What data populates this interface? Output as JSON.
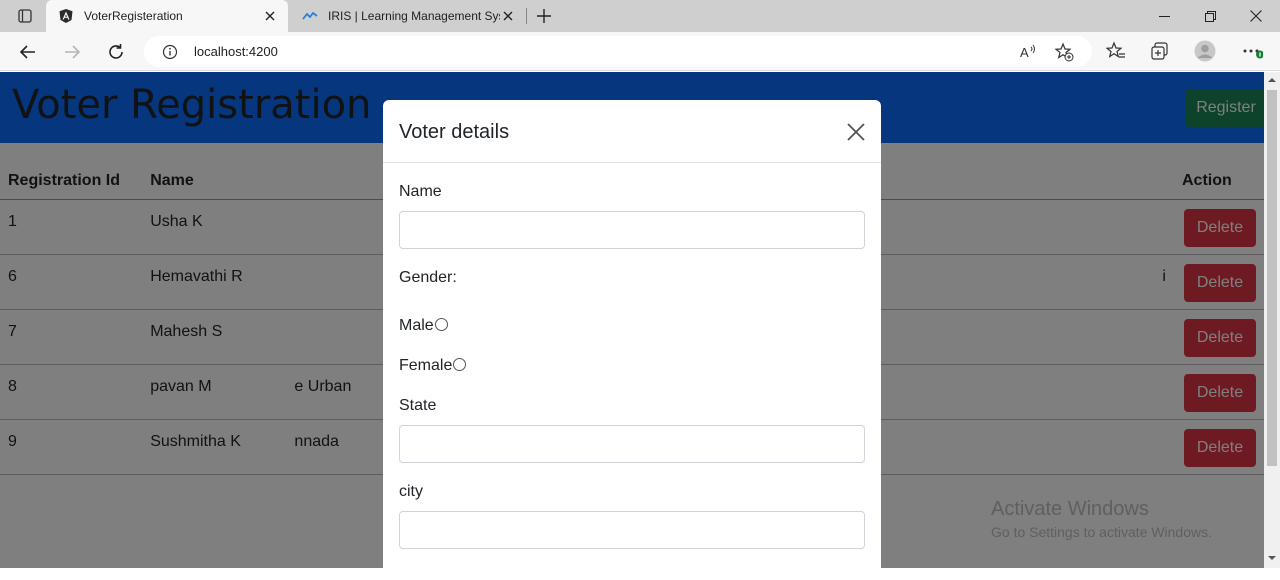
{
  "browser": {
    "tabs": [
      {
        "label": "VoterRegisteration",
        "icon": "angular-icon"
      },
      {
        "label": "IRIS | Learning Management Syst",
        "icon": "iris-icon"
      }
    ],
    "url": "localhost:4200"
  },
  "header": {
    "title": "Voter Registration",
    "register_label": "Register"
  },
  "table": {
    "columns": [
      "Registration Id",
      "Name",
      "",
      "Action"
    ],
    "rows": [
      {
        "id": "1",
        "name": "Usha K",
        "city": "",
        "action": "Delete"
      },
      {
        "id": "6",
        "name": "Hemavathi R",
        "city": "i",
        "action": "Delete"
      },
      {
        "id": "7",
        "name": "Mahesh S",
        "city": "",
        "action": "Delete"
      },
      {
        "id": "8",
        "name": "pavan M",
        "city": "e Urban",
        "action": "Delete"
      },
      {
        "id": "9",
        "name": "Sushmitha K",
        "city": "nnada",
        "action": "Delete"
      }
    ]
  },
  "modal": {
    "title": "Voter details",
    "name_label": "Name",
    "name_value": "",
    "gender_label": "Gender:",
    "gender_options": [
      "Male",
      "Female"
    ],
    "state_label": "State",
    "state_value": "",
    "city_label": "city",
    "city_value": ""
  },
  "watermark": {
    "line1": "Activate Windows",
    "line2": "Go to Settings to activate Windows."
  },
  "colors": {
    "header_bg": "#0d6efd",
    "register_btn": "#198754",
    "delete_btn": "#dc3545"
  }
}
